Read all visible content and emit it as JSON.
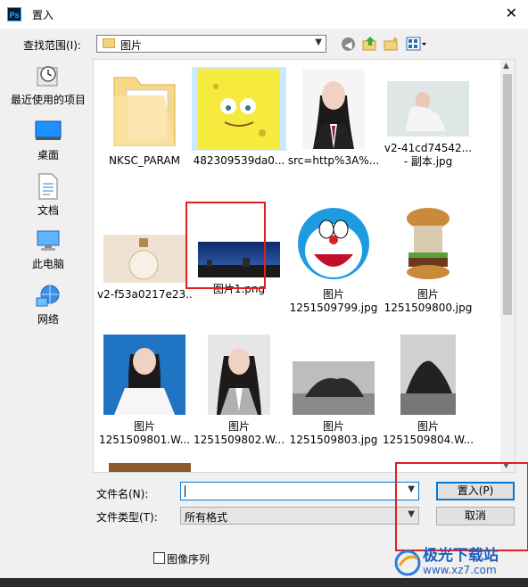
{
  "window": {
    "title": "置入",
    "app_icon": "Ps",
    "close_glyph": "✕"
  },
  "lookin": {
    "label": "查找范围(I):",
    "value": "图片"
  },
  "places": [
    {
      "label": "最近使用的项目",
      "icon": "recent-icon"
    },
    {
      "label": "桌面",
      "icon": "desktop-icon"
    },
    {
      "label": "文档",
      "icon": "documents-icon"
    },
    {
      "label": "此电脑",
      "icon": "computer-icon"
    },
    {
      "label": "网络",
      "icon": "network-icon"
    }
  ],
  "files": [
    {
      "label": "NKSC_PARAM",
      "kind": "folder"
    },
    {
      "label": "482309539da0...",
      "kind": "spongebob",
      "selected": true
    },
    {
      "label": "src=http%3A%...",
      "kind": "portrait"
    },
    {
      "label": "v2-41cd74542...",
      "label2": "- 副本.jpg",
      "kind": "woman"
    },
    {
      "label": "v2-f53a0217e23...",
      "kind": "bottle"
    },
    {
      "label": "图片1.png",
      "kind": "night"
    },
    {
      "label": "图片",
      "label2": "1251509799.jpg",
      "kind": "doraemon"
    },
    {
      "label": "图片",
      "label2": "1251509800.jpg",
      "kind": "burger"
    },
    {
      "label": "图片",
      "label2": "1251509801.W...",
      "kind": "idphoto"
    },
    {
      "label": "图片",
      "label2": "1251509802.W...",
      "kind": "portrait2"
    },
    {
      "label": "图片",
      "label2": "1251509803.jpg",
      "kind": "rock"
    },
    {
      "label": "图片",
      "label2": "1251509804.W...",
      "kind": "rock2"
    }
  ],
  "filename": {
    "label": "文件名(N):",
    "value": ""
  },
  "filetype": {
    "label": "文件类型(T):",
    "value": "所有格式"
  },
  "buttons": {
    "place": "置入(P)",
    "cancel": "取消"
  },
  "sequence": {
    "label": "图像序列"
  },
  "watermark": {
    "brand": "极光下载站",
    "url": "www.xz7.com"
  }
}
